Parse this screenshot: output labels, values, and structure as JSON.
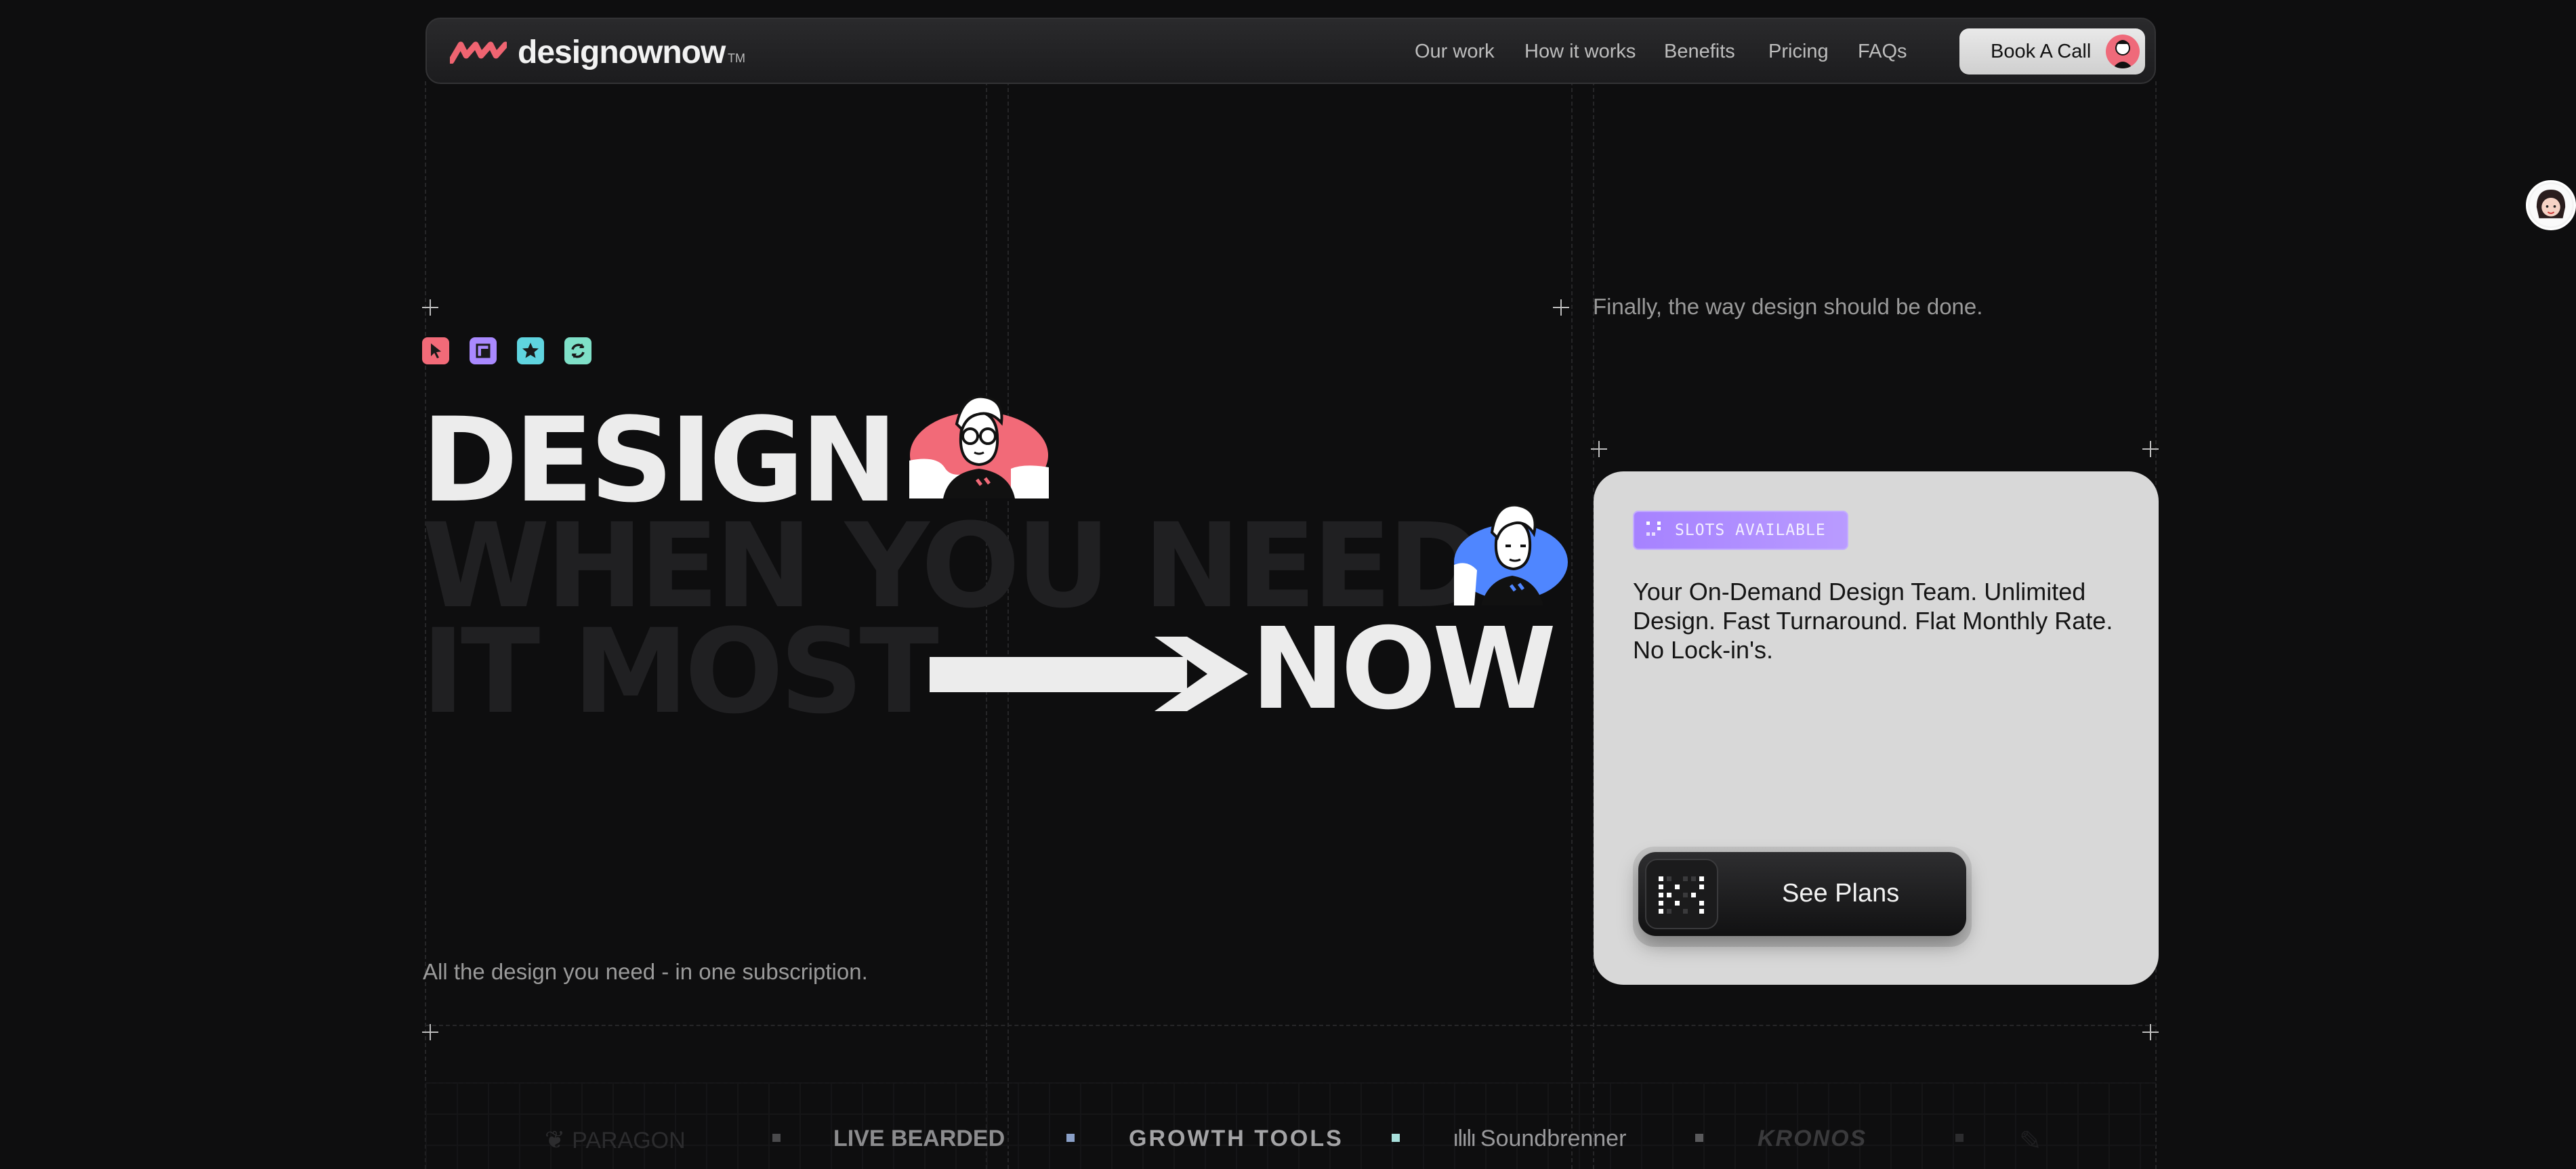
{
  "brand": {
    "name": "designownow",
    "tm": "TM",
    "accent": "#ef6471"
  },
  "nav": {
    "links": [
      "Our work",
      "How it works",
      "Benefits",
      "Pricing",
      "FAQs"
    ],
    "cta": "Book A Call"
  },
  "hero": {
    "top_tagline": "Finally, the way design should be done.",
    "line1": "DESIGN",
    "line2": "WHEN YOU NEED",
    "line3a": "IT MOST",
    "line3b": "NOW",
    "bottom_tagline": "All the design you need - in one subscription.",
    "feature_icons": [
      {
        "name": "cursor-icon",
        "color": "#f26a78"
      },
      {
        "name": "layout-icon",
        "color": "#a989ff"
      },
      {
        "name": "star-icon",
        "color": "#5fd4df"
      },
      {
        "name": "refresh-icon",
        "color": "#7fe0c8"
      }
    ]
  },
  "card": {
    "badge": "SLOTS AVAILABLE",
    "description": "Your On-Demand Design Team. Unlimited Design. Fast Turnaround. Flat Monthly Rate. No Lock-in's.",
    "button": "See Plans"
  },
  "clients": [
    "PARAGON",
    "LIVE BEARDED",
    "GROWTH TOOLS",
    "Soundbrenner",
    "KRONOS"
  ]
}
